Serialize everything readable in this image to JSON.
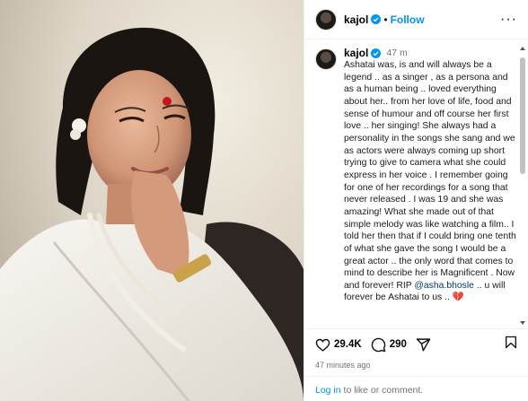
{
  "header": {
    "username": "kajol",
    "verified_icon": "verified-badge-icon",
    "separator": "•",
    "follow_label": "Follow",
    "more_icon": "more-options-icon",
    "more_glyph": "···"
  },
  "caption": {
    "username": "kajol",
    "time": "47 m",
    "text_before_mention": "Ashatai was, is and will always be a legend .. as a singer , as a persona and as a human being .. loved everything about her.. from her love of life, food and sense of humour and off course her first love .. her singing! She always had a personality in the songs she sang and we as actors were always coming up short trying to give to camera what she could express in her voice . I remember going for one of her recordings for a song that never released . I was 19 and she was amazing! What she made out of that simple melody was like watching a film.. I told her then that if I could bring one tenth of what she gave the song I would be a great actor .. the only word that comes to mind to describe her is Magnificent . Now and forever! RIP ",
    "mention": "@asha.bhosle",
    "text_after_mention": " .. u will forever be Ashatai to us .. ",
    "emoji": "💔"
  },
  "actions": {
    "like_icon": "heart-icon",
    "likes": "29.4K",
    "comment_icon": "comment-icon",
    "comments": "290",
    "share_icon": "share-icon",
    "save_icon": "bookmark-icon",
    "posted_ago": "47 minutes ago"
  },
  "login": {
    "link_text": "Log in",
    "rest_text": " to like or comment."
  },
  "colors": {
    "link_blue": "#0095f6",
    "verified_blue": "#0095f6",
    "mention_blue": "#00376b",
    "muted_gray": "#737373",
    "heart_red": "#e0245e"
  }
}
